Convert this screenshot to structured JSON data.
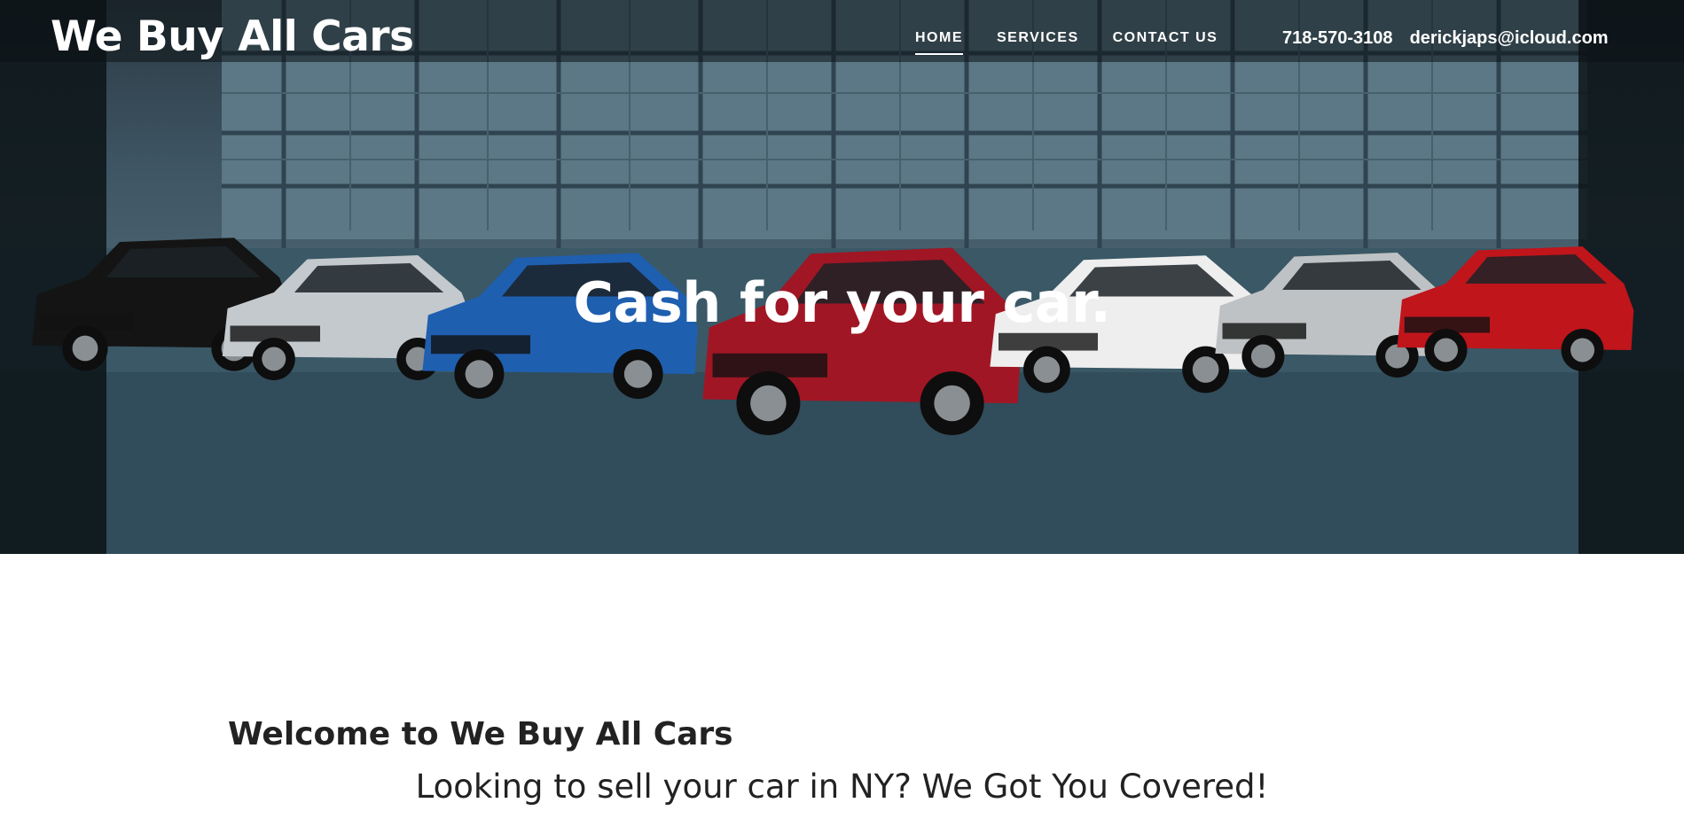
{
  "header": {
    "site_title": "We Buy All Cars",
    "nav": [
      {
        "label": "HOME",
        "active": true
      },
      {
        "label": "SERVICES",
        "active": false
      },
      {
        "label": "CONTACT US",
        "active": false
      }
    ],
    "phone": "718-570-3108",
    "email": "derickjaps@icloud.com"
  },
  "hero": {
    "headline": "Cash for your car.",
    "car_colors": [
      "#141414",
      "#c4c9cd",
      "#1f5fb0",
      "#a11624",
      "#eeeeee",
      "#bfc2c4",
      "#c0151b"
    ]
  },
  "content": {
    "welcome_heading": "Welcome to We Buy All Cars",
    "tagline": "Looking to sell your car in NY? We Got You Covered!"
  }
}
